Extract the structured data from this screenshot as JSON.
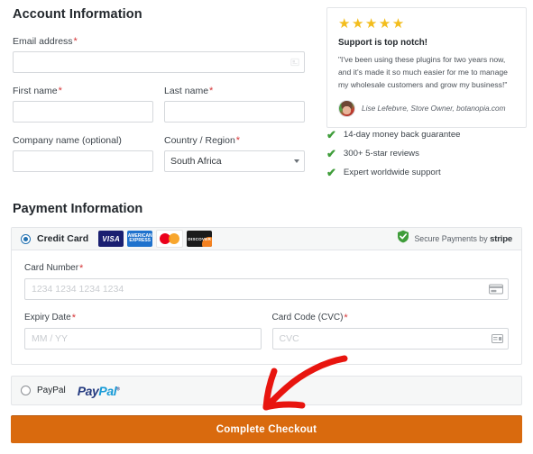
{
  "account": {
    "title": "Account Information",
    "email": {
      "label": "Email address",
      "required": "*",
      "value": "",
      "placeholder": "",
      "icon": "contact-card-icon"
    },
    "first_name": {
      "label": "First name",
      "required": "*",
      "value": "",
      "placeholder": ""
    },
    "last_name": {
      "label": "Last name",
      "required": "*",
      "value": "",
      "placeholder": ""
    },
    "company": {
      "label": "Company name (optional)",
      "value": "",
      "placeholder": ""
    },
    "country": {
      "label": "Country / Region",
      "required": "*",
      "value": "South Africa",
      "options": [
        "South Africa"
      ]
    }
  },
  "testimonial": {
    "stars": "★★★★★",
    "star_count": 5,
    "star_color": "#f3bd1d",
    "headline": "Support is top notch!",
    "quote": "\"I've been using these plugins for two years now, and it's made it so much easier for me to manage my wholesale customers and grow my business!\"",
    "author": "Lise Lefebvre, Store Owner, botanopia.com"
  },
  "benefits": {
    "check_color": "#3f9d3a",
    "items": [
      {
        "icon": "check-icon",
        "label": "14-day money back guarantee"
      },
      {
        "icon": "check-icon",
        "label": "300+ 5-star reviews"
      },
      {
        "icon": "check-icon",
        "label": "Expert worldwide support"
      }
    ]
  },
  "payment": {
    "title": "Payment Information",
    "credit_card": {
      "label": "Credit Card",
      "selected": true,
      "cards": [
        {
          "name": "visa-card-logo",
          "text": "VISA"
        },
        {
          "name": "amex-card-logo",
          "text": "AMERICAN EXPRESS"
        },
        {
          "name": "mastercard-card-logo",
          "text": "mastercard"
        },
        {
          "name": "discover-card-logo",
          "text": "DISCOVER"
        }
      ]
    },
    "stripe_badge": {
      "icon": "shield-check-icon",
      "prefix": "Secure Payments by",
      "brand": "stripe",
      "color": "#3f9d3a"
    },
    "card_number": {
      "label": "Card Number",
      "required": "*",
      "value": "",
      "placeholder": "1234 1234 1234 1234",
      "icon": "credit-card-icon"
    },
    "expiry": {
      "label": "Expiry Date",
      "required": "*",
      "value": "",
      "placeholder": "MM / YY"
    },
    "cvc": {
      "label": "Card Code (CVC)",
      "required": "*",
      "value": "",
      "placeholder": "CVC",
      "icon": "cvc-card-icon"
    },
    "paypal": {
      "label": "PayPal",
      "selected": false,
      "logo_a": "Pay",
      "logo_b": "Pal",
      "trademark": "®"
    }
  },
  "checkout": {
    "label": "Complete Checkout",
    "color": "#d96a0e"
  },
  "annotation": {
    "type": "arrow",
    "color": "#e8150f",
    "points_to": "complete-checkout-button"
  }
}
